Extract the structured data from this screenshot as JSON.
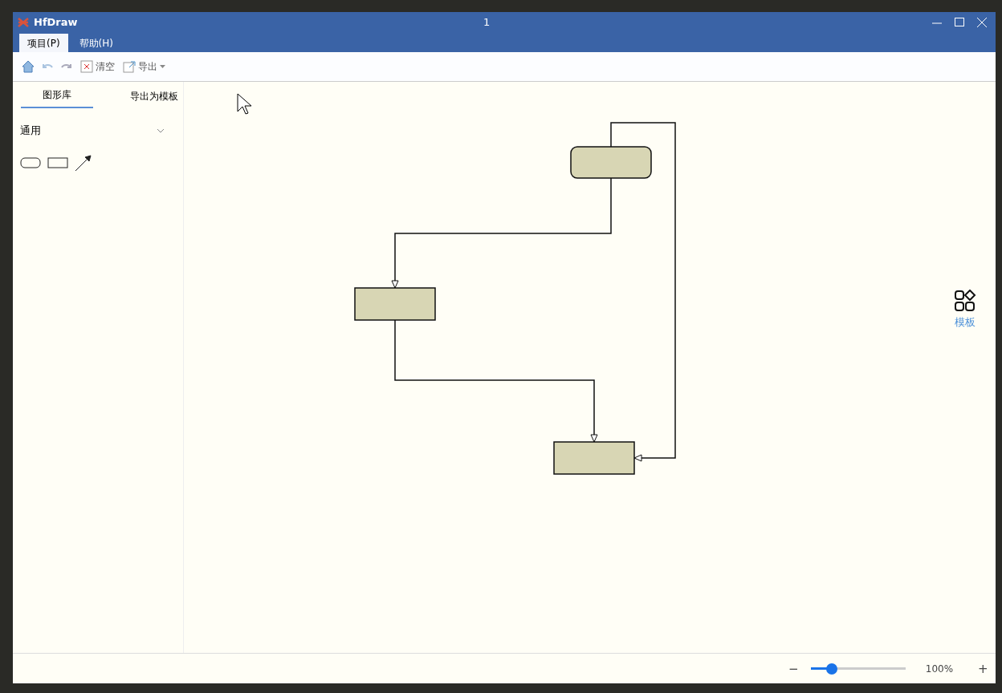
{
  "window": {
    "app_name": "HfDraw",
    "title": "1"
  },
  "menu_tabs": [
    {
      "label": "项目(P)",
      "selected": true
    },
    {
      "label": "帮助(H)",
      "selected": false
    }
  ],
  "toolbar": {
    "clear": "清空",
    "export": "导出"
  },
  "sidebar": {
    "tabs": [
      {
        "label": "图形库",
        "selected": true
      }
    ],
    "tooltip": "导出为模板",
    "group": {
      "title": "通用",
      "expanded": true
    }
  },
  "diagram": {
    "nodes": [
      {
        "kind": "rounded"
      },
      {
        "kind": "rect"
      },
      {
        "kind": "rect"
      }
    ]
  },
  "template_button": "模板",
  "zoom": {
    "level": 0.22,
    "reading": "100%",
    "minus": "−",
    "plus": "+"
  }
}
